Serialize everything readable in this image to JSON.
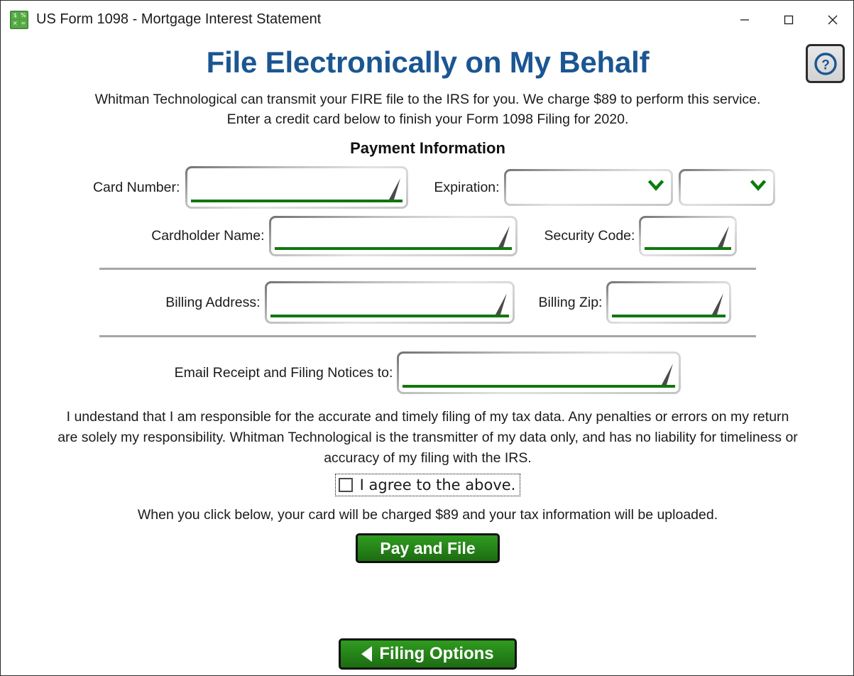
{
  "window": {
    "title": "US Form 1098 - Mortgage Interest Statement",
    "app_icon": "spreadsheet-calculator-icon",
    "icon_glyphs": [
      "$",
      "%",
      "×",
      "="
    ],
    "controls": {
      "minimize": "minimize-icon",
      "maximize": "maximize-icon",
      "close": "close-icon"
    }
  },
  "help": {
    "icon": "question-mark-icon",
    "glyph": "?",
    "color": "#1b5692"
  },
  "page": {
    "title": "File Electronically on My Behalf",
    "title_color": "#1b5692",
    "intro": "Whitman Technological can transmit your FIRE file to the IRS for you. We charge $89 to perform this service. Enter a credit card below to finish your Form 1098 Filing for 2020.",
    "section_title": "Payment Information"
  },
  "fields": {
    "card_number": {
      "label": "Card Number:",
      "value": "",
      "placeholder": ""
    },
    "expiration": {
      "label": "Expiration:",
      "month_value": "",
      "year_value": "",
      "chevron": "chevron-down-icon"
    },
    "cardholder_name": {
      "label": "Cardholder Name:",
      "value": "",
      "placeholder": ""
    },
    "security_code": {
      "label": "Security Code:",
      "value": "",
      "placeholder": ""
    },
    "billing_address": {
      "label": "Billing Address:",
      "value": "",
      "placeholder": ""
    },
    "billing_zip": {
      "label": "Billing Zip:",
      "value": "",
      "placeholder": ""
    },
    "email": {
      "label": "Email Receipt and Filing Notices to:",
      "value": "",
      "placeholder": ""
    }
  },
  "agreement": {
    "disclaimer": "I undestand that I am responsible for the accurate and timely filing of my tax data. Any penalties or errors on my return are solely my responsibility. Whitman Technological is the transmitter of my data only, and has no liability for timeliness or accuracy of my filing with the IRS.",
    "checkbox_label": "I agree to the above.",
    "checked": false
  },
  "actions": {
    "charge_note": "When you click below, your card will be charged $89 and your tax information will be uploaded.",
    "pay_button": "Pay and File",
    "filing_options_button": "Filing Options",
    "filing_options_icon": "triangle-left-icon",
    "button_color": "#27861a"
  }
}
